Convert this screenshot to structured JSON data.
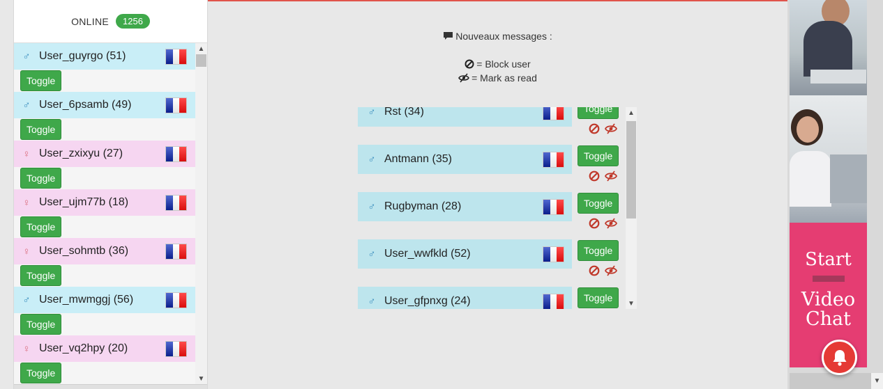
{
  "sidebar": {
    "online_label": "ONLINE",
    "online_count": "1256",
    "users": [
      {
        "name": "User_guyrgo (51)",
        "gender": "male",
        "flag": "france-flag",
        "toggle_label": "Toggle"
      },
      {
        "name": "User_6psamb (49)",
        "gender": "male",
        "flag": "france-flag",
        "toggle_label": "Toggle"
      },
      {
        "name": "User_zxixyu (27)",
        "gender": "female",
        "flag": "france-flag",
        "toggle_label": "Toggle"
      },
      {
        "name": "User_ujm77b (18)",
        "gender": "female",
        "flag": "france-flag",
        "toggle_label": "Toggle"
      },
      {
        "name": "User_sohmtb (36)",
        "gender": "female",
        "flag": "france-flag",
        "toggle_label": "Toggle"
      },
      {
        "name": "User_mwmggj (56)",
        "gender": "male",
        "flag": "france-flag",
        "toggle_label": "Toggle"
      },
      {
        "name": "User_vq2hpy (20)",
        "gender": "female",
        "flag": "france-flag",
        "toggle_label": "Toggle"
      }
    ]
  },
  "main": {
    "new_messages_label": "Nouveaux messages :",
    "legend": {
      "block_text": "= Block user",
      "read_text": "= Mark as read"
    },
    "conversations": [
      {
        "name": "Rst (34)",
        "gender": "male",
        "flag": "france-flag",
        "toggle_label": "Toggle"
      },
      {
        "name": "Antmann (35)",
        "gender": "male",
        "flag": "france-flag",
        "toggle_label": "Toggle"
      },
      {
        "name": "Rugbyman (28)",
        "gender": "male",
        "flag": "france-flag",
        "toggle_label": "Toggle"
      },
      {
        "name": "User_wwfkld (52)",
        "gender": "male",
        "flag": "france-flag",
        "toggle_label": "Toggle"
      },
      {
        "name": "User_gfpnxg (24)",
        "gender": "male",
        "flag": "france-flag",
        "toggle_label": "Toggle"
      }
    ]
  },
  "ad": {
    "cta_line1": "Start",
    "cta_line2": "Video",
    "cta_line3": "Chat"
  },
  "colors": {
    "accent_green": "#3fa84a",
    "male_row": "#c9eef7",
    "female_row": "#f6d6f1",
    "conversation_row": "#bde5ed",
    "ad_pink": "#e53d72",
    "notification_red": "#e53a35"
  },
  "icons": {
    "male": "male-icon",
    "female": "female-icon",
    "block": "block-icon",
    "mark_read": "eye-slash-icon",
    "comment": "comment-icon",
    "bell": "bell-icon"
  }
}
